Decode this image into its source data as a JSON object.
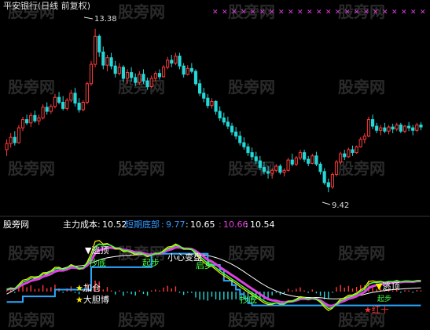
{
  "chart_data": [
    {
      "type": "candlestick",
      "title": "平安银行(日线 前复权)",
      "annotations": {
        "high_label": "13.38",
        "low_label": "9.42"
      },
      "y_range": [
        9.1,
        13.7
      ],
      "candles": [
        [
          10.45,
          10.7,
          10.3,
          10.6
        ],
        [
          10.6,
          10.85,
          10.5,
          10.75
        ],
        [
          10.75,
          10.9,
          10.55,
          10.62
        ],
        [
          10.62,
          11.05,
          10.6,
          10.98
        ],
        [
          10.98,
          11.25,
          10.9,
          11.18
        ],
        [
          11.18,
          11.3,
          11.05,
          11.1
        ],
        [
          11.1,
          11.35,
          11.0,
          11.28
        ],
        [
          11.28,
          11.4,
          11.1,
          11.15
        ],
        [
          11.15,
          11.3,
          11.05,
          11.22
        ],
        [
          11.22,
          11.55,
          11.18,
          11.48
        ],
        [
          11.48,
          11.6,
          11.3,
          11.38
        ],
        [
          11.38,
          11.55,
          11.32,
          11.5
        ],
        [
          11.5,
          11.8,
          11.45,
          11.72
        ],
        [
          11.72,
          11.85,
          11.55,
          11.6
        ],
        [
          11.6,
          11.75,
          11.4,
          11.45
        ],
        [
          11.45,
          11.7,
          11.4,
          11.65
        ],
        [
          11.65,
          11.9,
          11.6,
          11.82
        ],
        [
          11.82,
          11.95,
          11.5,
          11.58
        ],
        [
          11.58,
          11.7,
          11.35,
          11.42
        ],
        [
          11.42,
          11.65,
          11.38,
          11.6
        ],
        [
          11.6,
          12.1,
          11.55,
          12.05
        ],
        [
          12.05,
          12.6,
          12.0,
          12.52
        ],
        [
          12.52,
          13.38,
          12.45,
          13.2
        ],
        [
          13.2,
          13.25,
          12.7,
          12.82
        ],
        [
          12.82,
          12.95,
          12.4,
          12.5
        ],
        [
          12.5,
          12.75,
          12.35,
          12.68
        ],
        [
          12.68,
          12.8,
          12.4,
          12.48
        ],
        [
          12.48,
          12.6,
          12.2,
          12.3
        ],
        [
          12.3,
          12.55,
          12.25,
          12.45
        ],
        [
          12.45,
          12.5,
          12.1,
          12.18
        ],
        [
          12.18,
          12.4,
          12.05,
          12.32
        ],
        [
          12.32,
          12.45,
          12.1,
          12.2
        ],
        [
          12.2,
          12.3,
          12.0,
          12.08
        ],
        [
          12.08,
          12.35,
          12.02,
          12.28
        ],
        [
          12.28,
          12.4,
          12.05,
          12.12
        ],
        [
          12.12,
          12.2,
          11.9,
          11.98
        ],
        [
          11.98,
          12.25,
          11.95,
          12.18
        ],
        [
          12.18,
          12.35,
          12.1,
          12.3
        ],
        [
          12.3,
          12.4,
          12.15,
          12.22
        ],
        [
          12.22,
          12.5,
          12.2,
          12.45
        ],
        [
          12.45,
          12.7,
          12.4,
          12.62
        ],
        [
          12.62,
          12.75,
          12.45,
          12.55
        ],
        [
          12.55,
          12.8,
          12.5,
          12.72
        ],
        [
          12.72,
          12.8,
          12.4,
          12.48
        ],
        [
          12.48,
          12.55,
          12.2,
          12.28
        ],
        [
          12.28,
          12.5,
          12.25,
          12.42
        ],
        [
          12.42,
          12.55,
          12.3,
          12.35
        ],
        [
          12.35,
          12.4,
          12.0,
          12.05
        ],
        [
          12.05,
          12.15,
          11.75,
          11.82
        ],
        [
          11.82,
          11.95,
          11.6,
          11.7
        ],
        [
          11.7,
          11.8,
          11.45,
          11.52
        ],
        [
          11.52,
          11.7,
          11.45,
          11.62
        ],
        [
          11.62,
          11.65,
          11.3,
          11.38
        ],
        [
          11.38,
          11.5,
          11.15,
          11.22
        ],
        [
          11.22,
          11.35,
          11.05,
          11.12
        ],
        [
          11.12,
          11.25,
          10.95,
          11.02
        ],
        [
          11.02,
          11.1,
          10.8,
          10.88
        ],
        [
          10.88,
          11.0,
          10.7,
          10.78
        ],
        [
          10.78,
          10.9,
          10.55,
          10.62
        ],
        [
          10.62,
          10.75,
          10.45,
          10.52
        ],
        [
          10.52,
          10.6,
          10.3,
          10.38
        ],
        [
          10.38,
          10.5,
          10.2,
          10.28
        ],
        [
          10.28,
          10.4,
          10.1,
          10.18
        ],
        [
          10.18,
          10.3,
          9.95,
          10.02
        ],
        [
          10.02,
          10.15,
          9.85,
          9.92
        ],
        [
          9.92,
          10.05,
          9.75,
          9.88
        ],
        [
          9.88,
          10.0,
          9.75,
          9.95
        ],
        [
          9.95,
          10.1,
          9.9,
          10.05
        ],
        [
          10.05,
          10.1,
          9.85,
          9.9
        ],
        [
          9.9,
          10.0,
          9.8,
          9.95
        ],
        [
          9.95,
          10.25,
          9.92,
          10.2
        ],
        [
          10.2,
          10.35,
          10.05,
          10.1
        ],
        [
          10.1,
          10.3,
          10.05,
          10.25
        ],
        [
          10.25,
          10.45,
          10.2,
          10.38
        ],
        [
          10.38,
          10.45,
          10.15,
          10.22
        ],
        [
          10.22,
          10.3,
          10.05,
          10.12
        ],
        [
          10.12,
          10.35,
          10.1,
          10.3
        ],
        [
          10.3,
          10.4,
          10.05,
          10.1
        ],
        [
          10.1,
          10.15,
          9.85,
          9.92
        ],
        [
          9.92,
          10.0,
          9.6,
          9.65
        ],
        [
          9.65,
          9.75,
          9.42,
          9.55
        ],
        [
          9.55,
          9.9,
          9.5,
          9.85
        ],
        [
          9.85,
          10.2,
          9.8,
          10.15
        ],
        [
          10.15,
          10.4,
          10.1,
          10.35
        ],
        [
          10.35,
          10.45,
          10.2,
          10.28
        ],
        [
          10.28,
          10.5,
          10.25,
          10.45
        ],
        [
          10.45,
          10.55,
          10.3,
          10.38
        ],
        [
          10.38,
          10.55,
          10.35,
          10.52
        ],
        [
          10.52,
          10.75,
          10.5,
          10.7
        ],
        [
          10.7,
          10.85,
          10.6,
          10.78
        ],
        [
          10.78,
          11.25,
          10.75,
          11.18
        ],
        [
          11.18,
          11.3,
          10.95,
          11.02
        ],
        [
          11.02,
          11.1,
          10.85,
          10.92
        ],
        [
          10.92,
          11.05,
          10.8,
          10.98
        ],
        [
          10.98,
          11.1,
          10.85,
          10.9
        ],
        [
          10.9,
          11.05,
          10.82,
          11.0
        ],
        [
          11.0,
          11.08,
          10.85,
          10.95
        ],
        [
          10.95,
          11.1,
          10.9,
          11.05
        ],
        [
          11.05,
          11.1,
          10.85,
          10.9
        ],
        [
          10.9,
          11.05,
          10.85,
          11.02
        ],
        [
          11.02,
          11.12,
          10.9,
          10.98
        ],
        [
          10.98,
          11.05,
          10.8,
          10.92
        ],
        [
          10.92,
          11.1,
          10.88,
          11.05
        ],
        [
          11.05,
          11.12,
          10.92,
          11.0
        ]
      ]
    },
    {
      "type": "line",
      "indicator_values": [
        {
          "label": "主力成本",
          "value": "10.52"
        },
        {
          "label": "短期底部",
          "value": "9.77"
        },
        {
          "label": "",
          "value": "10.65"
        },
        {
          "label": "",
          "value": "10.66"
        },
        {
          "label": "",
          "value": "10.54"
        }
      ],
      "series": [
        {
          "name": "主力成本",
          "values": [
            10.4,
            10.5,
            10.6,
            10.7,
            10.8,
            10.9,
            11.0,
            11.1,
            11.15,
            11.2,
            11.3,
            11.4,
            11.45,
            11.5,
            11.55,
            11.6,
            11.62,
            11.64,
            11.66,
            11.68,
            11.72,
            11.78,
            11.85,
            11.92,
            11.98,
            12.02,
            12.05,
            12.08,
            12.1,
            12.12,
            12.13,
            12.14,
            12.15,
            12.16,
            12.17,
            12.18,
            12.18,
            12.18,
            12.18,
            12.19,
            12.2,
            12.21,
            12.22,
            12.22,
            12.22,
            12.22,
            12.21,
            12.2,
            12.18,
            12.15,
            12.12,
            12.08,
            12.03,
            11.97,
            11.9,
            11.82,
            11.73,
            11.63,
            11.52,
            11.4,
            11.28,
            11.16,
            11.04,
            10.92,
            10.81,
            10.71,
            10.62,
            10.54,
            10.47,
            10.41,
            10.36,
            10.32,
            10.29,
            10.27,
            10.26,
            10.25,
            10.25,
            10.25,
            10.24,
            10.22,
            10.2,
            10.19,
            10.19,
            10.2,
            10.22,
            10.25,
            10.28,
            10.31,
            10.35,
            10.39,
            10.44,
            10.48,
            10.51,
            10.54,
            10.56,
            10.58,
            10.6,
            10.62,
            10.63,
            10.64,
            10.65,
            10.66,
            10.67,
            10.68
          ]
        },
        {
          "name": "短期底部",
          "values": [
            10.05,
            10.05,
            10.05,
            10.05,
            10.3,
            10.3,
            10.3,
            10.3,
            10.3,
            10.3,
            10.3,
            10.3,
            10.6,
            10.6,
            10.6,
            10.6,
            10.6,
            10.6,
            10.6,
            10.6,
            10.6,
            11.6,
            11.6,
            11.6,
            11.6,
            11.6,
            11.6,
            11.6,
            11.6,
            11.6,
            11.6,
            11.6,
            11.6,
            11.6,
            11.6,
            11.6,
            12.2,
            12.2,
            12.2,
            12.2,
            12.2,
            12.2,
            12.2,
            12.2,
            12.2,
            12.2,
            12.2,
            12.2,
            12.2,
            12.2,
            11.7,
            11.7,
            11.7,
            11.5,
            11.0,
            11.0,
            10.8,
            10.6,
            10.4,
            10.2,
            10.0,
            9.9,
            9.9,
            9.9,
            9.9,
            9.9,
            9.9,
            9.9,
            9.9,
            9.9,
            9.9,
            9.9,
            9.9,
            9.9,
            9.9,
            9.9,
            9.9,
            9.9,
            9.9,
            9.9,
            9.9,
            9.9,
            9.9,
            9.9,
            9.9,
            9.9,
            9.9,
            9.9,
            9.9,
            9.9,
            9.9,
            9.9,
            9.9,
            9.9,
            9.9,
            9.9,
            9.9,
            9.9,
            9.9,
            9.9,
            9.9,
            9.9,
            9.9,
            9.9
          ]
        }
      ],
      "annotations": [
        "逃顶",
        "抄底",
        "起步",
        "小心变盘",
        "启步",
        "抄底",
        "加仓",
        "大胆博",
        "逃顶",
        "红十",
        "起步"
      ]
    }
  ],
  "header": {
    "brand": "股旁网"
  },
  "watermark": "股旁网",
  "colors": {
    "up": "#ff3a3a",
    "down": "#22d8d8",
    "cost": "#ffffff",
    "bottom": "#2aa8ff",
    "magenta": "#e040e0",
    "yellow": "#ffee00",
    "green": "#44ff44"
  }
}
